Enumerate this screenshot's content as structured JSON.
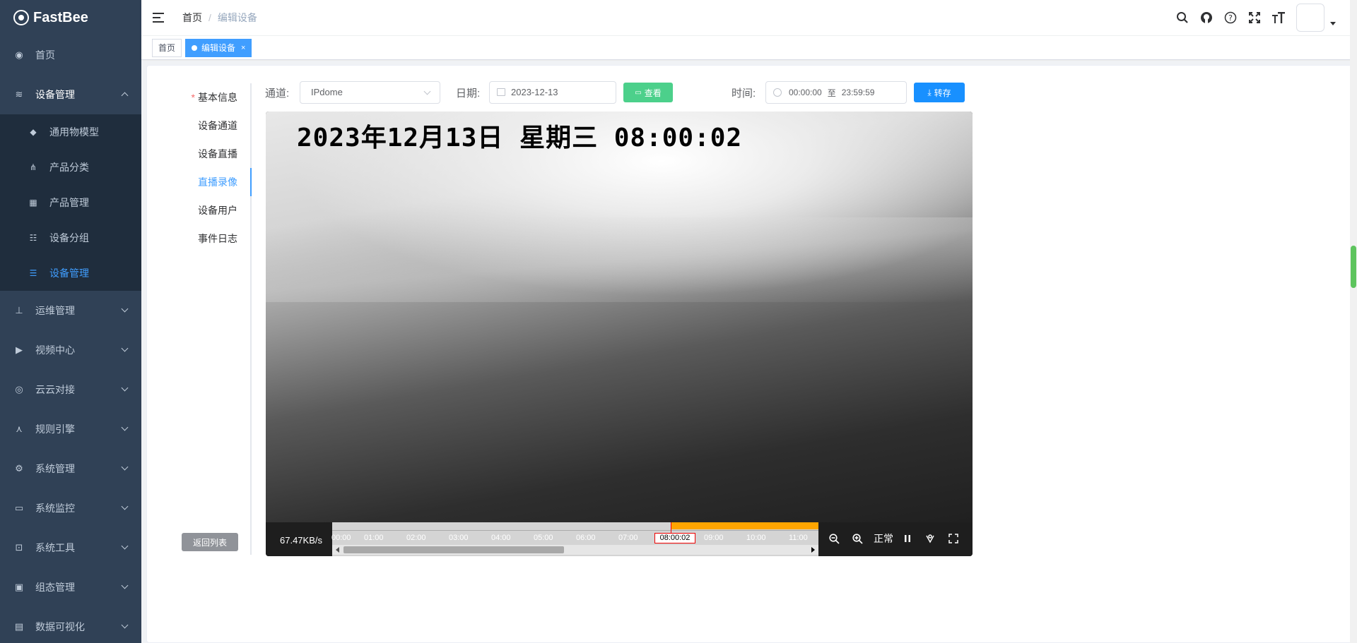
{
  "app": {
    "name": "FastBee"
  },
  "sidebar": {
    "items": [
      {
        "label": "首页",
        "icon": "dashboard-icon"
      },
      {
        "label": "设备管理",
        "icon": "device-icon",
        "open": true,
        "children": [
          {
            "label": "通用物模型",
            "icon": "cube-icon"
          },
          {
            "label": "产品分类",
            "icon": "tree-icon"
          },
          {
            "label": "产品管理",
            "icon": "grid-icon"
          },
          {
            "label": "设备分组",
            "icon": "group-icon"
          },
          {
            "label": "设备管理",
            "icon": "list-icon",
            "active": true
          }
        ]
      },
      {
        "label": "运维管理",
        "icon": "tree-table-icon"
      },
      {
        "label": "视频中心",
        "icon": "camera-icon"
      },
      {
        "label": "云云对接",
        "icon": "eye-icon"
      },
      {
        "label": "规则引擎",
        "icon": "share-icon"
      },
      {
        "label": "系统管理",
        "icon": "gear-icon"
      },
      {
        "label": "系统监控",
        "icon": "monitor-icon"
      },
      {
        "label": "系统工具",
        "icon": "toolbox-icon"
      },
      {
        "label": "组态管理",
        "icon": "display-icon"
      },
      {
        "label": "数据可视化",
        "icon": "screen-icon"
      }
    ]
  },
  "breadcrumb": {
    "home": "首页",
    "sep": "/",
    "current": "编辑设备"
  },
  "tags": {
    "home": "首页",
    "current": "编辑设备",
    "close": "×"
  },
  "tabs": {
    "basic": "基本信息",
    "channel": "设备通道",
    "live": "设备直播",
    "record": "直播录像",
    "users": "设备用户",
    "log": "事件日志",
    "required_mark": "*"
  },
  "back_button": "返回列表",
  "toolbar": {
    "channel_label": "通道:",
    "channel_value": "IPdome",
    "date_label": "日期:",
    "date_value": "2023-12-13",
    "view_button": "查看",
    "time_label": "时间:",
    "time_start": "00:00:00",
    "time_to": "至",
    "time_end": "23:59:59",
    "save_button": "转存"
  },
  "player": {
    "osd_text": "2023年12月13日  星期三  08:00:02",
    "speed": "67.47KB/s",
    "ticks": [
      "00:00",
      "01:00",
      "02:00",
      "03:00",
      "04:00",
      "05:00",
      "06:00",
      "07:00",
      "09:00",
      "10:00",
      "11:00"
    ],
    "current_time": "08:00:02",
    "rate": "正常"
  }
}
